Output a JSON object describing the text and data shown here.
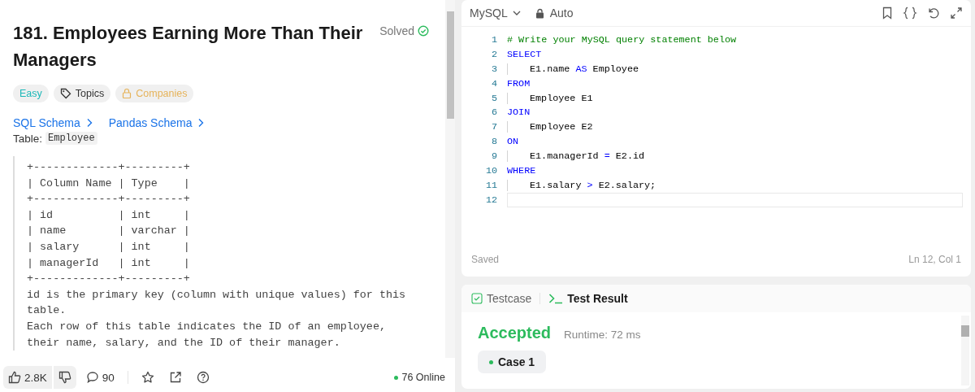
{
  "problem": {
    "title": "181. Employees Earning More Than Their Managers",
    "status": "Solved",
    "solved": true,
    "tags": [
      {
        "label": "Easy",
        "kind": "difficulty"
      },
      {
        "label": "Topics",
        "kind": "topics"
      },
      {
        "label": "Companies",
        "kind": "companies"
      }
    ],
    "schema_links": [
      "SQL Schema",
      "Pandas Schema"
    ],
    "table_label": "Table:",
    "table_name": "Employee",
    "schema_block": "+-------------+---------+\n| Column Name | Type    |\n+-------------+---------+\n| id          | int     |\n| name        | varchar |\n| salary      | int     |\n| managerId   | int     |\n+-------------+---------+",
    "description": [
      "id is the primary key (column with unique values) for this table.",
      "Each row of this table indicates the ID of an employee, their name, salary, and the ID of their manager."
    ]
  },
  "footer": {
    "likes": "2.8K",
    "comments": "90",
    "online": "76 Online"
  },
  "editor": {
    "language": "MySQL",
    "mode": "Auto",
    "lines": [
      {
        "number": "1",
        "indented": false,
        "tokens": [
          {
            "text": "# Write your MySQL query statement below",
            "kind": "comment"
          }
        ]
      },
      {
        "number": "2",
        "indented": false,
        "tokens": [
          {
            "text": "SELECT",
            "kind": "keyword"
          }
        ]
      },
      {
        "number": "3",
        "indented": true,
        "tokens": [
          {
            "text": "E1.name ",
            "kind": "plain"
          },
          {
            "text": "AS",
            "kind": "keyword"
          },
          {
            "text": " Employee",
            "kind": "plain"
          }
        ]
      },
      {
        "number": "4",
        "indented": false,
        "tokens": [
          {
            "text": "FROM",
            "kind": "keyword"
          }
        ]
      },
      {
        "number": "5",
        "indented": true,
        "tokens": [
          {
            "text": "Employee E1",
            "kind": "plain"
          }
        ]
      },
      {
        "number": "6",
        "indented": false,
        "tokens": [
          {
            "text": "JOIN",
            "kind": "keyword"
          }
        ]
      },
      {
        "number": "7",
        "indented": true,
        "tokens": [
          {
            "text": "Employee E2",
            "kind": "plain"
          }
        ]
      },
      {
        "number": "8",
        "indented": false,
        "tokens": [
          {
            "text": "ON",
            "kind": "keyword"
          }
        ]
      },
      {
        "number": "9",
        "indented": true,
        "tokens": [
          {
            "text": "E1.managerId ",
            "kind": "plain"
          },
          {
            "text": "=",
            "kind": "keyword"
          },
          {
            "text": " E2.id",
            "kind": "plain"
          }
        ]
      },
      {
        "number": "10",
        "indented": false,
        "tokens": [
          {
            "text": "WHERE",
            "kind": "keyword"
          }
        ]
      },
      {
        "number": "11",
        "indented": true,
        "tokens": [
          {
            "text": "E1.salary ",
            "kind": "plain"
          },
          {
            "text": ">",
            "kind": "keyword"
          },
          {
            "text": " E2.salary;",
            "kind": "plain"
          }
        ]
      },
      {
        "number": "12"
      }
    ],
    "save_state": "Saved",
    "cursor": "Ln 12, Col 1"
  },
  "result": {
    "tabs": [
      {
        "label": "Testcase",
        "kind": "testcase",
        "selected": false
      },
      {
        "label": "Test Result",
        "kind": "result",
        "selected": true
      }
    ],
    "verdict": "Accepted",
    "runtime": "Runtime: 72 ms",
    "cases": [
      {
        "label": "Case 1",
        "selected": true
      }
    ]
  }
}
